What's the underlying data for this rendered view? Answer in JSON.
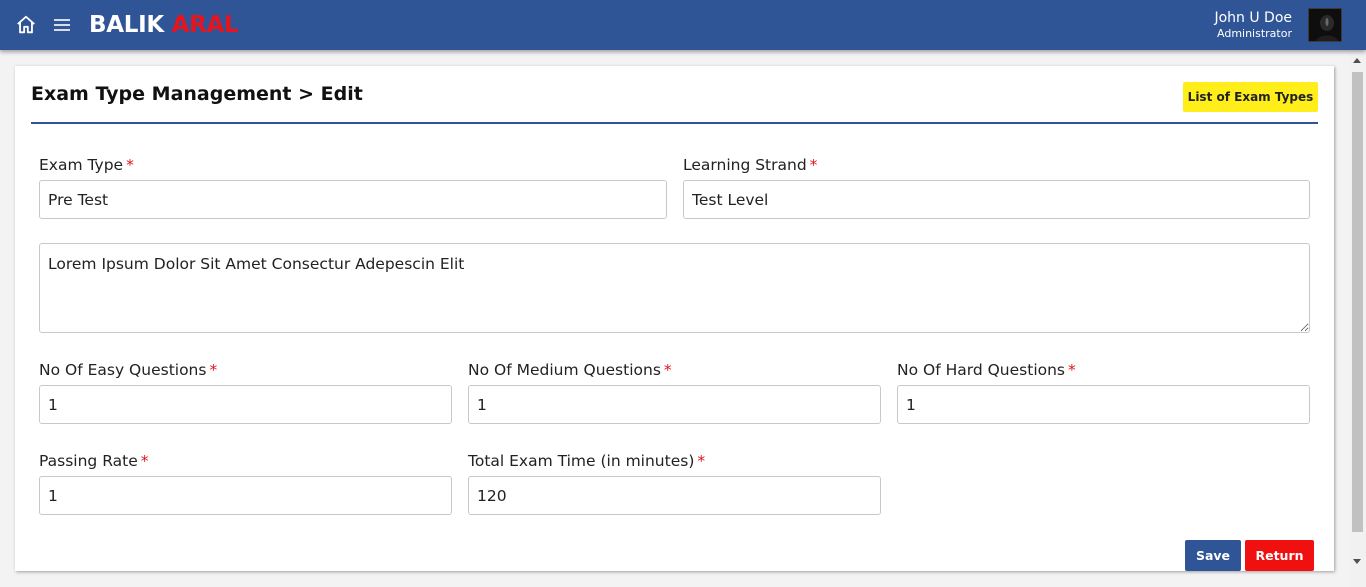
{
  "header": {
    "brand_part1": "BALIK",
    "brand_part2": "ARAL",
    "user_name": "John U Doe",
    "user_role": "Administrator",
    "icons": [
      "home-icon",
      "hamburger-menu-icon"
    ],
    "colors": {
      "bar": "#2f5597",
      "brand_accent": "#e8141d"
    }
  },
  "page": {
    "title": "Exam Type Management > Edit",
    "list_button_label": "List of Exam Types"
  },
  "form": {
    "exam_type_label": "Exam Type",
    "exam_type_value": "Pre Test",
    "learning_strand_label": "Learning Strand",
    "learning_strand_value": "Test Level",
    "description_value": "Lorem Ipsum Dolor Sit Amet Consectur Adepescin Elit",
    "easy_label": "No Of Easy Questions",
    "easy_value": "1",
    "medium_label": "No Of Medium Questions",
    "medium_value": "1",
    "hard_label": "No Of Hard Questions",
    "hard_value": "1",
    "passing_rate_label": "Passing Rate",
    "passing_rate_value": "1",
    "total_time_label": "Total Exam Time (in minutes)",
    "total_time_value": "120",
    "required_mark": "*"
  },
  "actions": {
    "save_label": "Save",
    "return_label": "Return",
    "colors": {
      "save": "#2f5597",
      "return": "#f01010",
      "list": "#ffee1a"
    }
  }
}
